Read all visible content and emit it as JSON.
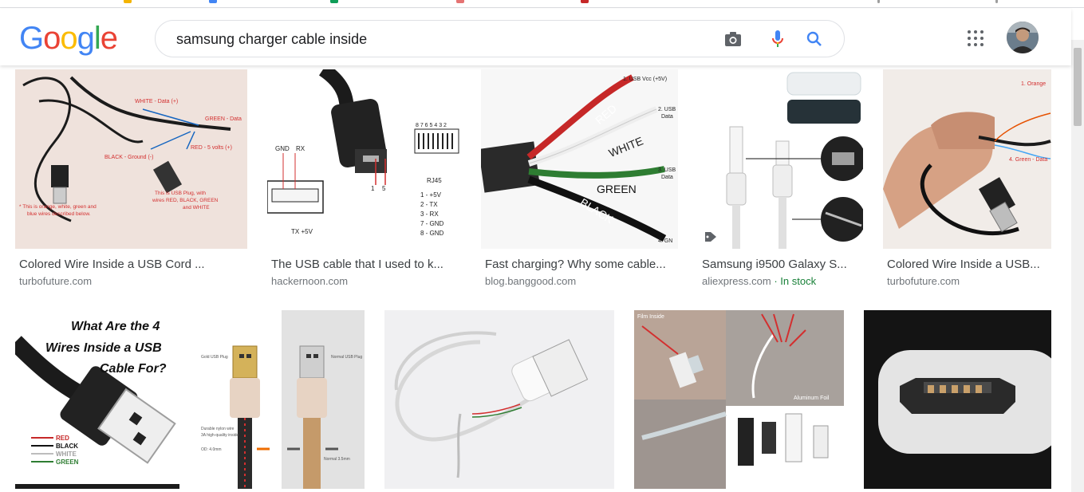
{
  "search": {
    "query": "samsung charger cable inside"
  },
  "logo": {
    "text": "Google"
  },
  "results_row1": [
    {
      "title": "Colored Wire Inside a USB Cord ...",
      "source": "turbofuture.com"
    },
    {
      "title": "The USB cable that I used to k...",
      "source": "hackernoon.com"
    },
    {
      "title": "Fast charging? Why some cable...",
      "source": "blog.banggood.com"
    },
    {
      "title": "Samsung i9500 Galaxy S...",
      "source": "aliexpress.com",
      "stock": "· In stock"
    },
    {
      "title": "Colored Wire Inside a USB...",
      "source": "turbofuture.com"
    }
  ],
  "img_text": {
    "t1_white": "WHITE - Data (+)",
    "t1_green": "GREEN - Data",
    "t1_black": "BLACK - Ground (-)",
    "t1_red": "RED - 5 volts (+)",
    "t1_note1": "* This is orange, white, green and",
    "t1_note2": "blue wires described below.",
    "t1_note3": "This is USB Plug, with",
    "t1_note4": "wires RED, BLACK, GREEN",
    "t1_note5": "and WHITE",
    "t2_gnd": "GND",
    "t2_rx": "RX",
    "t2_tx": "TX +5V",
    "t2_rj": "RJ45",
    "t2_pins": "8 7 6 5 4 3 2",
    "t2_l1": "1 - +5V",
    "t2_l2": "2 - TX",
    "t2_l3": "3 - RX",
    "t2_l4": "7 - GND",
    "t2_l5": "8 - GND",
    "t2_n1": "1",
    "t2_n5": "5",
    "t3_red": "RED",
    "t3_white": "WHITE",
    "t3_green": "GREEN",
    "t3_black": "BLACK",
    "t3_l1": "1. USB Vcc (+5V)",
    "t3_l2a": "2. USB",
    "t3_l2b": "Data",
    "t3_l3a": "3. USB",
    "t3_l3b": "Data",
    "t3_l4": "4. GN",
    "t5_orange": "1. Orange",
    "t5_green": "4. Green - Data",
    "b1_q1": "What Are the 4",
    "b1_q2": "Wires Inside a USB",
    "b1_q3": "Cable For?",
    "b1_red": "RED",
    "b1_black": "BLACK",
    "b1_white": "WHITE",
    "b1_green": "GREEN",
    "b2_gold": "Gold USB Plug",
    "b2_normal": "Normal USB Plug",
    "b2_nylon": "Durable nylon wire",
    "b2_nylon2": "3A high-quality inside",
    "b2_od": "OD: 4.0mm",
    "b2_normal2": "Normal 3.5mm",
    "b4_film": "Film Inside",
    "b4_al": "Aluminum Foil"
  },
  "colors": {
    "blue": "#4285f4",
    "red": "#ea4335",
    "yellow": "#fbbc05",
    "green": "#34a853"
  }
}
